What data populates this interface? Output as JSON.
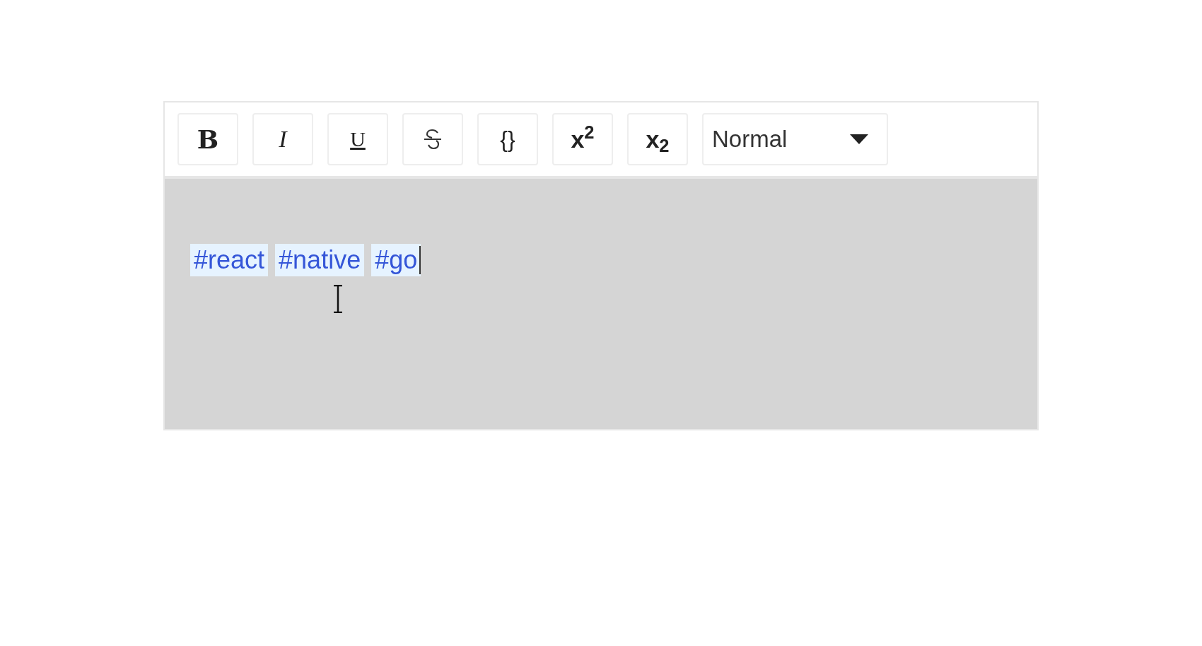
{
  "toolbar": {
    "buttons": [
      {
        "kind": "bold",
        "label": "B"
      },
      {
        "kind": "italic",
        "label": "I"
      },
      {
        "kind": "underline",
        "label": "U"
      },
      {
        "kind": "strike"
      },
      {
        "kind": "code",
        "label": "{}"
      },
      {
        "kind": "superscript",
        "label": "x$^{2}$"
      },
      {
        "kind": "subscript",
        "label": "x$_{2}$"
      }
    ],
    "block_type": {
      "value": "Normal"
    }
  },
  "editor": {
    "hashtags": [
      "#react",
      "#native",
      "#go"
    ]
  }
}
